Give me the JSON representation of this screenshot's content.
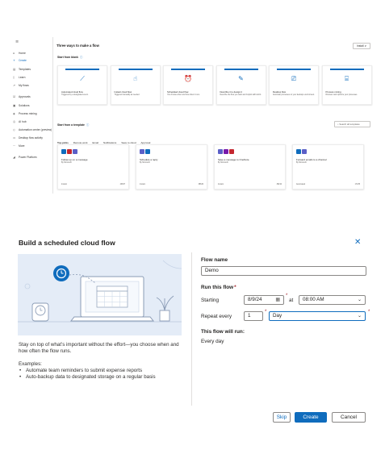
{
  "colors": {
    "accent": "#0f6cbd",
    "illustration_bg": "#e4ecf7",
    "required": "#a4262c"
  },
  "portal": {
    "nav": [
      {
        "icon": "home-icon",
        "glyph": "⌂",
        "label": "Home"
      },
      {
        "icon": "plus-icon",
        "glyph": "+",
        "label": "Create"
      },
      {
        "icon": "templates-icon",
        "glyph": "▤",
        "label": "Templates"
      },
      {
        "icon": "learn-icon",
        "glyph": "▯",
        "label": "Learn"
      },
      {
        "icon": "flows-icon",
        "glyph": "↗",
        "label": "My flows"
      },
      {
        "icon": "approvals-icon",
        "glyph": "☑",
        "label": "Approvals"
      },
      {
        "icon": "solutions-icon",
        "glyph": "▣",
        "label": "Solutions"
      },
      {
        "icon": "process-mining-icon",
        "glyph": "◈",
        "label": "Process mining"
      },
      {
        "icon": "ai-hub-icon",
        "glyph": "◎",
        "label": "AI hub"
      },
      {
        "icon": "automation-center-icon",
        "glyph": "◇",
        "label": "Automation center (preview)"
      },
      {
        "icon": "desktop-flow-icon",
        "glyph": "▭",
        "label": "Desktop flow activity"
      },
      {
        "icon": "more-icon",
        "glyph": "···",
        "label": "More"
      },
      {
        "icon": "power-platform-icon",
        "glyph": "◢",
        "label": "Power Platform"
      }
    ],
    "title": "Three ways to make a flow",
    "share": "Install ∨",
    "start_blank": "Start from blank",
    "start_cards": [
      {
        "icon": "automated-flow-icon",
        "glyph": "⟋",
        "title": "Automated cloud flow",
        "desc": "Triggered by a designated event."
      },
      {
        "icon": "instant-flow-icon",
        "glyph": "☝",
        "title": "Instant cloud flow",
        "desc": "Triggered manually as needed."
      },
      {
        "icon": "scheduled-flow-icon",
        "glyph": "⏰",
        "title": "Scheduled cloud flow",
        "desc": "You choose when and how often it runs."
      },
      {
        "icon": "describe-design-icon",
        "glyph": "✎",
        "title": "Describe it to design it",
        "desc": "Describe the flow you want and Copilot will build it."
      },
      {
        "icon": "desktop-flow-card-icon",
        "glyph": "⎚",
        "title": "Desktop flow",
        "desc": "Automate processes on your desktop environment."
      },
      {
        "icon": "process-mining-card-icon",
        "glyph": "⌸",
        "title": "Process mining",
        "desc": "Discover and optimize your processes."
      }
    ],
    "start_template": "Start from a template",
    "template_search": "Search all templates",
    "tabs": [
      "Top picks",
      "Remote work",
      "Email",
      "Notifications",
      "Save to cloud",
      "Approval"
    ],
    "templates": [
      {
        "title": "Follow up on a message",
        "by": "By Microsoft",
        "type": "Instant",
        "count": "43837",
        "icons": [
          "#0f6cbd",
          "#c4262e",
          "#5b5fc7"
        ]
      },
      {
        "title": "Schedule a reply",
        "by": "By Microsoft",
        "type": "Instant",
        "count": "38630",
        "icons": [
          "#5b5fc7",
          "#0f6cbd"
        ]
      },
      {
        "title": "Save a message to OneNote",
        "by": "By Microsoft",
        "type": "Instant",
        "count": "38210",
        "icons": [
          "#5b5fc7",
          "#7719aa",
          "#c4262e"
        ]
      },
      {
        "title": "Forward emails to a channel",
        "by": "By Microsoft",
        "type": "Automated",
        "count": "17235",
        "icons": [
          "#0f6cbd",
          "#5b5fc7"
        ]
      }
    ]
  },
  "dialog": {
    "title": "Build a scheduled cloud flow",
    "description": "Stay on top of what’s important without the effort—you choose when and how often the flow runs.",
    "examples_label": "Examples:",
    "examples": [
      "Automate team reminders to submit expense reports",
      "Auto-backup data to designated storage on a regular basis"
    ],
    "flow_name_label": "Flow name",
    "flow_name_value": "Demo",
    "run_label": "Run this flow",
    "starting_label": "Starting",
    "start_date": "8/9/24",
    "at_label": "at",
    "start_time": "08:00 AM",
    "repeat_label": "Repeat every",
    "repeat_interval": "1",
    "repeat_unit": "Day",
    "will_run_label": "This flow will run:",
    "will_run_value": "Every day",
    "skip": "Skip",
    "create": "Create",
    "cancel": "Cancel"
  }
}
